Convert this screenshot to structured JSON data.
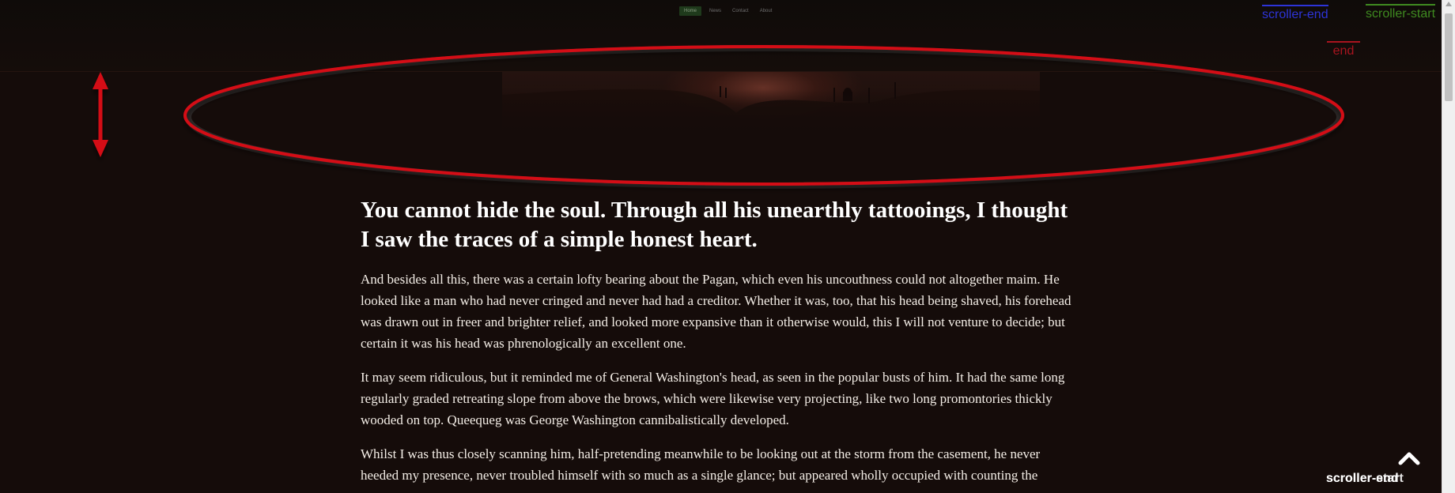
{
  "nav": {
    "items": [
      "Home",
      "News",
      "Contact",
      "About"
    ]
  },
  "markers": {
    "scroller_end": "scroller-end",
    "scroller_start": "scroller-start",
    "end": "end"
  },
  "article": {
    "heading": "You cannot hide the soul. Through all his unearthly tattooings, I thought I saw the traces of a simple honest heart.",
    "paragraphs": [
      "And besides all this, there was a certain lofty bearing about the Pagan, which even his uncouthness could not altogether maim. He looked like a man who had never cringed and never had had a creditor. Whether it was, too, that his head being shaved, his forehead was drawn out in freer and brighter relief, and looked more expansive than it otherwise would, this I will not venture to decide; but certain it was his head was phrenologically an excellent one.",
      "It may seem ridiculous, but it reminded me of General Washington's head, as seen in the popular busts of him. It had the same long regularly graded retreating slope from above the brows, which were likewise very projecting, like two long promontories thickly wooded on top. Queequeg was George Washington cannibalistically developed.",
      "Whilst I was thus closely scanning him, half-pretending meanwhile to be looking out at the storm from the casement, he never heeded my presence, never troubled himself with so much as a single glance; but appeared wholly occupied with counting the"
    ]
  },
  "bottom_labels": {
    "front": "scroller-end",
    "back": "scroller-start"
  },
  "icons": {
    "back_to_top": "chevron-up-icon",
    "resize_arrow": "vertical-double-arrow-icon",
    "highlight_ellipse": "red-ellipse-annotation"
  },
  "colors": {
    "background": "#150c0a",
    "annotation_red": "#d40f16",
    "scroller_end": "#2d34d8",
    "scroller_start": "#3f8b20",
    "end": "#a9141f"
  }
}
